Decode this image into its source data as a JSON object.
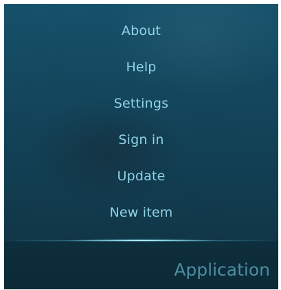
{
  "pulley_menu": {
    "items": [
      {
        "label": "About"
      },
      {
        "label": "Help"
      },
      {
        "label": "Settings"
      },
      {
        "label": "Sign in"
      },
      {
        "label": "Update"
      },
      {
        "label": "New item"
      }
    ]
  },
  "page_header": {
    "title": "Application"
  },
  "colors": {
    "menu_text": "#8fd3e8",
    "header_text": "#4d8ea3",
    "background": "#12465d",
    "header_background": "#0d2e3c",
    "highlight_glow": "#c8f5ff"
  }
}
